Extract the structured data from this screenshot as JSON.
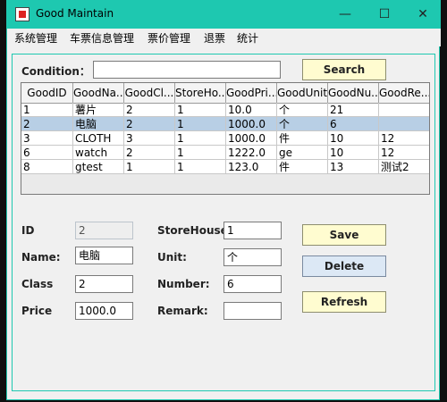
{
  "window": {
    "title": "Good Maintain",
    "minimize_icon": "minimize-icon",
    "maximize_icon": "maximize-icon",
    "close_icon": "close-icon"
  },
  "menu": [
    "系统管理",
    "车票信息管理",
    "票价管理",
    "退票",
    "统计"
  ],
  "search": {
    "label": "Condition：",
    "value": "",
    "button": "Search"
  },
  "table": {
    "columns": [
      "GoodID",
      "GoodNa...",
      "GoodCl...",
      "StoreHo...",
      "GoodPri...",
      "GoodUnit",
      "GoodNu...",
      "GoodRe..."
    ],
    "rows": [
      [
        "1",
        "薯片",
        "2",
        "1",
        "10.0",
        "个",
        "21",
        ""
      ],
      [
        "2",
        "电脑",
        "2",
        "1",
        "1000.0",
        "个",
        "6",
        ""
      ],
      [
        "3",
        "CLOTH",
        "3",
        "1",
        "1000.0",
        "件",
        "10",
        "12"
      ],
      [
        "6",
        "watch",
        "2",
        "1",
        "1222.0",
        "ge",
        "10",
        "12"
      ],
      [
        "8",
        "gtest",
        "1",
        "1",
        "123.0",
        "件",
        "13",
        "测试2"
      ]
    ],
    "selected_row": 1
  },
  "form": {
    "id": {
      "label": "ID",
      "value": "2"
    },
    "name": {
      "label": "Name:",
      "value": "电脑"
    },
    "class": {
      "label": "Class",
      "value": "2"
    },
    "price": {
      "label": "Price",
      "value": "1000.0"
    },
    "storehouse": {
      "label": "StoreHouse:",
      "value": "1"
    },
    "unit": {
      "label": "Unit:",
      "value": "个"
    },
    "number": {
      "label": "Number:",
      "value": "6"
    },
    "remark": {
      "label": "Remark:",
      "value": ""
    }
  },
  "buttons": {
    "save": "Save",
    "delete": "Delete",
    "refresh": "Refresh"
  }
}
